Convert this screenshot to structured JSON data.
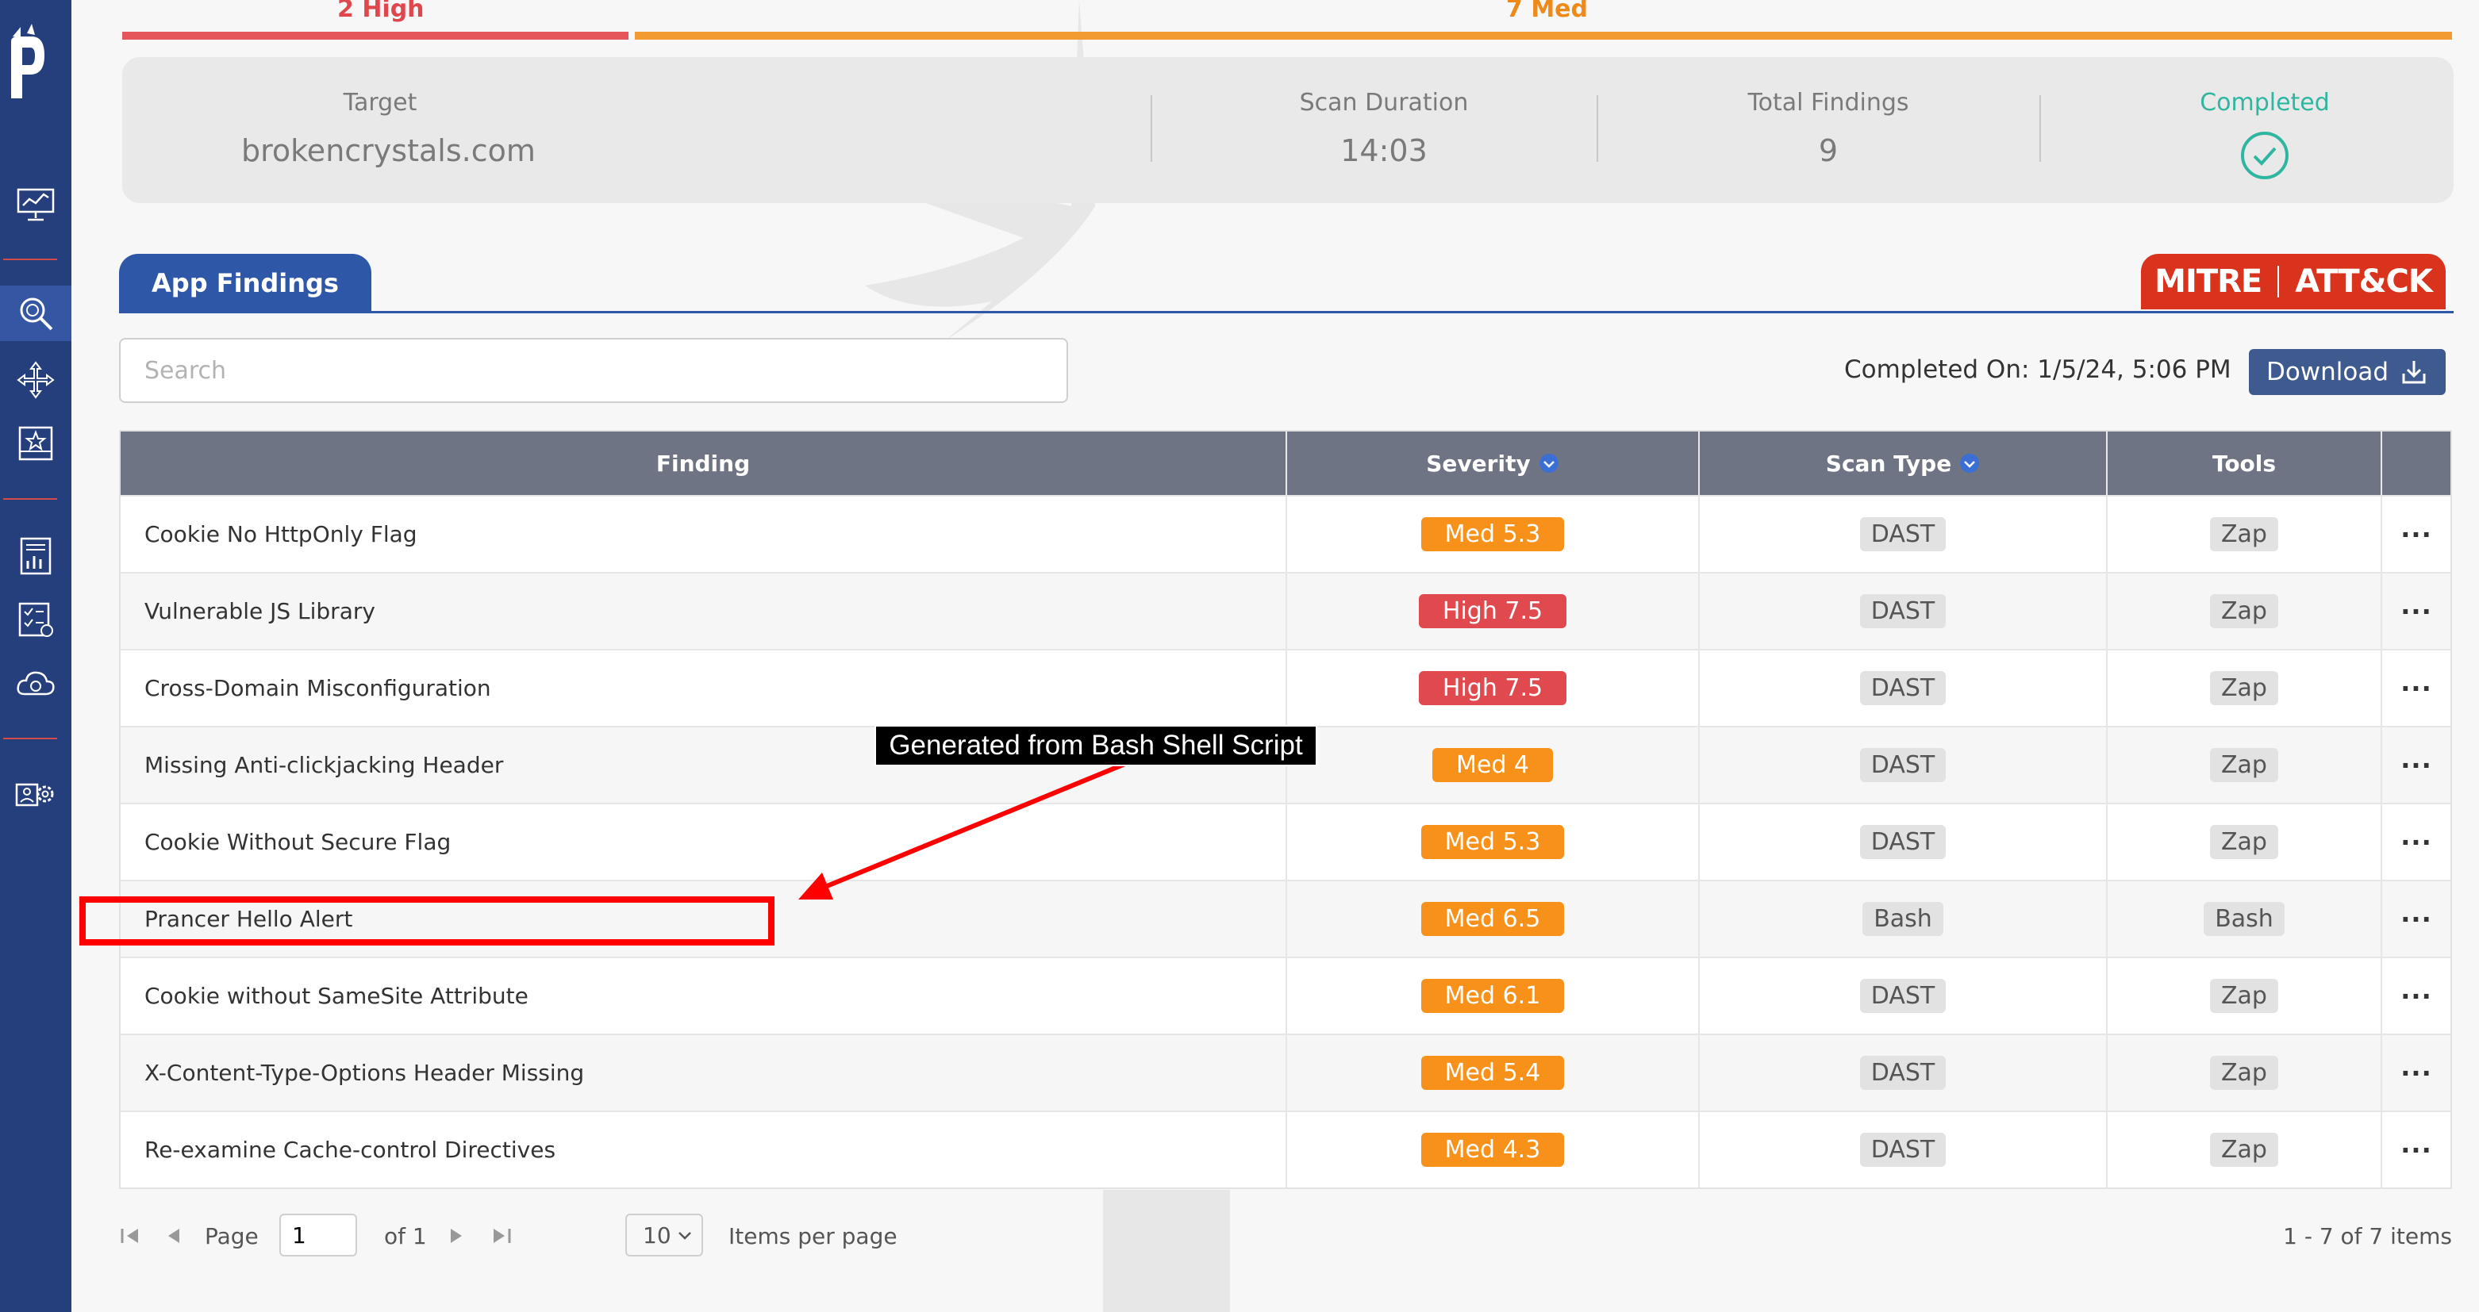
{
  "severity_summary": {
    "high_label": "2 High",
    "med_label": "7 Med",
    "high_fraction": 0.22,
    "med_fraction": 0.78
  },
  "summary": {
    "target_label": "Target",
    "target_value": "brokencrystals.com",
    "duration_label": "Scan Duration",
    "duration_value": "14:03",
    "total_label": "Total Findings",
    "total_value": "9",
    "status_label": "Completed"
  },
  "tabs": {
    "app_findings": "App Findings",
    "mitre_left": "MITRE",
    "mitre_right": "ATT&CK"
  },
  "toolbar": {
    "search_placeholder": "Search",
    "completed_on": "Completed On: 1/5/24, 5:06 PM",
    "download_label": "Download"
  },
  "table": {
    "headers": {
      "finding": "Finding",
      "severity": "Severity",
      "scan_type": "Scan Type",
      "tools": "Tools"
    },
    "rows": [
      {
        "finding": "Cookie No HttpOnly Flag",
        "severity": "Med 5.3",
        "level": "med",
        "scan_type": "DAST",
        "tool": "Zap"
      },
      {
        "finding": "Vulnerable JS Library",
        "severity": "High 7.5",
        "level": "high",
        "scan_type": "DAST",
        "tool": "Zap"
      },
      {
        "finding": "Cross-Domain Misconfiguration",
        "severity": "High 7.5",
        "level": "high",
        "scan_type": "DAST",
        "tool": "Zap"
      },
      {
        "finding": "Missing Anti-clickjacking Header",
        "severity": "Med 4",
        "level": "med",
        "scan_type": "DAST",
        "tool": "Zap"
      },
      {
        "finding": "Cookie Without Secure Flag",
        "severity": "Med 5.3",
        "level": "med",
        "scan_type": "DAST",
        "tool": "Zap"
      },
      {
        "finding": "Prancer Hello Alert",
        "severity": "Med 6.5",
        "level": "med",
        "scan_type": "Bash",
        "tool": "Bash"
      },
      {
        "finding": "Cookie without SameSite Attribute",
        "severity": "Med 6.1",
        "level": "med",
        "scan_type": "DAST",
        "tool": "Zap"
      },
      {
        "finding": "X-Content-Type-Options Header Missing",
        "severity": "Med 5.4",
        "level": "med",
        "scan_type": "DAST",
        "tool": "Zap"
      },
      {
        "finding": "Re-examine Cache-control Directives",
        "severity": "Med 4.3",
        "level": "med",
        "scan_type": "DAST",
        "tool": "Zap"
      }
    ],
    "row_menu": "···"
  },
  "annotation": {
    "callout": "Generated from Bash Shell Script"
  },
  "pagination": {
    "page_label": "Page",
    "page_value": "1",
    "of_label": "of 1",
    "per_page_value": "10",
    "per_page_label": "Items per page",
    "range_label": "1 - 7 of 7 items"
  },
  "colors": {
    "sidebar": "#253f7c",
    "high": "#e04a4f",
    "med": "#f7911a",
    "accent": "#2f57a8",
    "completed": "#2fb6a0",
    "mitre": "#d9321d"
  },
  "icons": {
    "sidebar": [
      "dashboard-icon",
      "search-scan-icon",
      "move-icon",
      "star-grid-icon",
      "report-icon",
      "checklist-icon",
      "cloud-icon",
      "settings-users-icon"
    ]
  }
}
